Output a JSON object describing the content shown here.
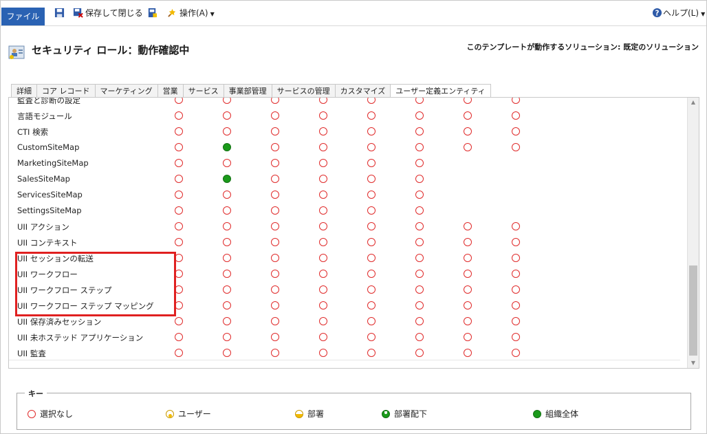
{
  "toolbar": {
    "file_label": "ファイル",
    "save_close_label": "保存して閉じる",
    "actions_label": "操作(A)",
    "help_label": "ヘルプ(L)"
  },
  "header": {
    "title": "セキュリティ ロール：動作確認中",
    "solution_label": "このテンプレートが動作するソリューション: 既定のソリューション"
  },
  "tabs": [
    "詳細",
    "コア レコード",
    "マーケティング",
    "営業",
    "サービス",
    "事業部管理",
    "サービスの管理",
    "カスタマイズ",
    "ユーザー定義エンティティ"
  ],
  "active_tab": "ユーザー定義エンティティ",
  "grid": {
    "rows": [
      {
        "label": "監査と診断の設定",
        "cells": [
          "none",
          "none",
          "none",
          "none",
          "none",
          "none",
          "none",
          "none"
        ]
      },
      {
        "label": "言語モジュール",
        "cells": [
          "none",
          "none",
          "none",
          "none",
          "none",
          "none",
          "none",
          "none"
        ]
      },
      {
        "label": "CTI 検索",
        "cells": [
          "none",
          "none",
          "none",
          "none",
          "none",
          "none",
          "none",
          "none"
        ]
      },
      {
        "label": "CustomSiteMap",
        "cells": [
          "none",
          "org",
          "none",
          "none",
          "none",
          "none",
          "none",
          "none"
        ]
      },
      {
        "label": "MarketingSiteMap",
        "cells": [
          "none",
          "none",
          "none",
          "none",
          "none",
          "none"
        ]
      },
      {
        "label": "SalesSiteMap",
        "cells": [
          "none",
          "org",
          "none",
          "none",
          "none",
          "none"
        ]
      },
      {
        "label": "ServicesSiteMap",
        "cells": [
          "none",
          "none",
          "none",
          "none",
          "none",
          "none"
        ]
      },
      {
        "label": "SettingsSiteMap",
        "cells": [
          "none",
          "none",
          "none",
          "none",
          "none",
          "none"
        ]
      },
      {
        "label": "UII アクション",
        "cells": [
          "none",
          "none",
          "none",
          "none",
          "none",
          "none",
          "none",
          "none"
        ]
      },
      {
        "label": "UII コンテキスト",
        "cells": [
          "none",
          "none",
          "none",
          "none",
          "none",
          "none",
          "none",
          "none"
        ]
      },
      {
        "label": "UII セッションの転送",
        "cells": [
          "none",
          "none",
          "none",
          "none",
          "none",
          "none",
          "none",
          "none"
        ]
      },
      {
        "label": "UII ワークフロー",
        "cells": [
          "none",
          "none",
          "none",
          "none",
          "none",
          "none",
          "none",
          "none"
        ]
      },
      {
        "label": "UII ワークフロー ステップ",
        "cells": [
          "none",
          "none",
          "none",
          "none",
          "none",
          "none",
          "none",
          "none"
        ]
      },
      {
        "label": "UII ワークフロー ステップ マッピング",
        "cells": [
          "none",
          "none",
          "none",
          "none",
          "none",
          "none",
          "none",
          "none"
        ]
      },
      {
        "label": "UII 保存済みセッション",
        "cells": [
          "none",
          "none",
          "none",
          "none",
          "none",
          "none",
          "none",
          "none"
        ]
      },
      {
        "label": "UII 未ホステッド アプリケーション",
        "cells": [
          "none",
          "none",
          "none",
          "none",
          "none",
          "none",
          "none",
          "none"
        ]
      },
      {
        "label": "UII 監査",
        "cells": [
          "none",
          "none",
          "none",
          "none",
          "none",
          "none",
          "none",
          "none"
        ]
      }
    ]
  },
  "legend": {
    "title": "キー",
    "items": [
      {
        "key": "none",
        "label": "選択なし"
      },
      {
        "key": "user",
        "label": "ユーザー"
      },
      {
        "key": "dept",
        "label": "部署"
      },
      {
        "key": "sub",
        "label": "部署配下"
      },
      {
        "key": "org",
        "label": "組織全体"
      }
    ]
  },
  "colors": {
    "file_button": "#2a62b3",
    "none_ring": "#e02b2b",
    "org_fill": "#1a9a1a",
    "highlight": "#e02020",
    "user_dept_fill": "#f2b900"
  }
}
